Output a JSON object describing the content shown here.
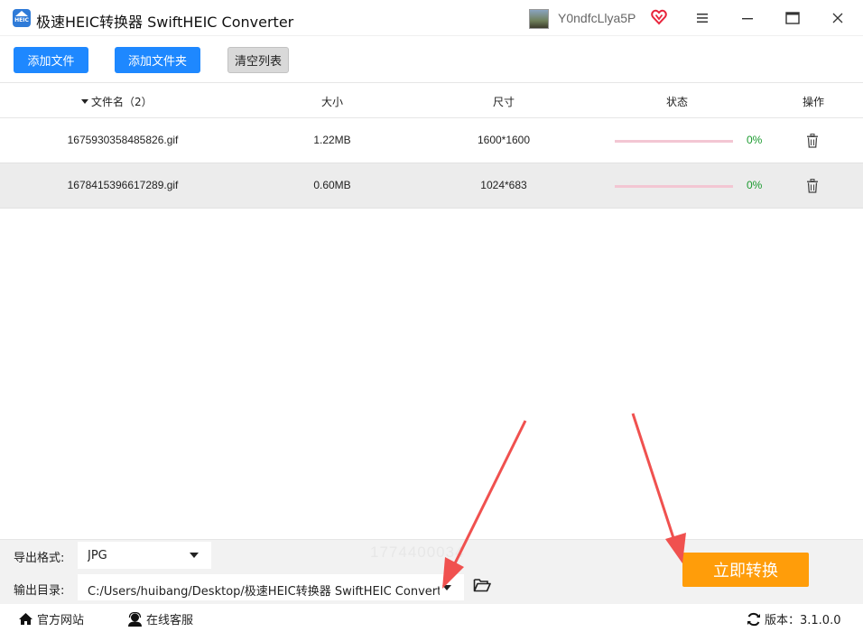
{
  "window": {
    "title": "极速HEIC转换器 SwiftHEIC Converter",
    "logo_text": "HEIC",
    "username": "Y0ndfcLlya5P"
  },
  "toolbar": {
    "add_file": "添加文件",
    "add_folder": "添加文件夹",
    "clear_list": "清空列表"
  },
  "table": {
    "headers": {
      "filename": "文件名（2）",
      "size": "大小",
      "dimensions": "尺寸",
      "status": "状态",
      "actions": "操作"
    },
    "rows": [
      {
        "filename": "1675930358485826.gif",
        "size": "1.22MB",
        "dimensions": "1600*1600",
        "progress": "0%",
        "progress_value": 0
      },
      {
        "filename": "1678415396617289.gif",
        "size": "0.60MB",
        "dimensions": "1024*683",
        "progress": "0%",
        "progress_value": 0
      }
    ]
  },
  "output": {
    "format_label": "导出格式:",
    "format_value": "JPG",
    "dir_label": "输出目录:",
    "dir_value": "C:/Users/huibang/Desktop/极速HEIC转换器 SwiftHEIC Converter",
    "convert_button": "立即转换",
    "ghost_text": "1774400034"
  },
  "status": {
    "website": "官方网站",
    "support": "在线客服",
    "version": "版本：3.1.0.0"
  },
  "colors": {
    "primary_blue": "#1e88ff",
    "convert_orange": "#ff9d0a",
    "progress_track": "#f3c6d3",
    "percent_green": "#1a9a2e",
    "annotation_red": "#f0514f"
  }
}
